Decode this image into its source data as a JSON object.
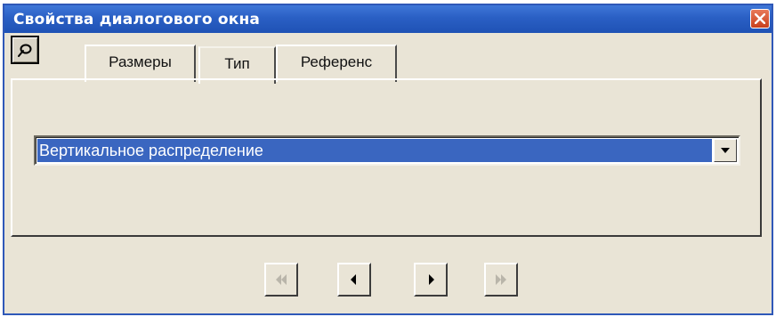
{
  "window": {
    "title": "Свойства диалогового окна"
  },
  "icons": {
    "close": "close-icon",
    "pin": "pin-icon",
    "dropdown": "chevron-down-icon",
    "first": "first-record-icon",
    "prev": "previous-record-icon",
    "next": "next-record-icon",
    "last": "last-record-icon"
  },
  "tabs": [
    {
      "label": "Размеры",
      "active": false
    },
    {
      "label": "Тип",
      "active": true
    },
    {
      "label": "Референс",
      "active": false
    }
  ],
  "type_select": {
    "value": "Вертикальное распределение"
  },
  "navigation": {
    "first_enabled": false,
    "prev_enabled": true,
    "next_enabled": true,
    "last_enabled": false
  },
  "colors": {
    "titlebar": "#2a5fc4",
    "window_bg": "#e9e4d6",
    "selection": "#3a66c0",
    "disabled_glyph": "#b9b5aa"
  }
}
